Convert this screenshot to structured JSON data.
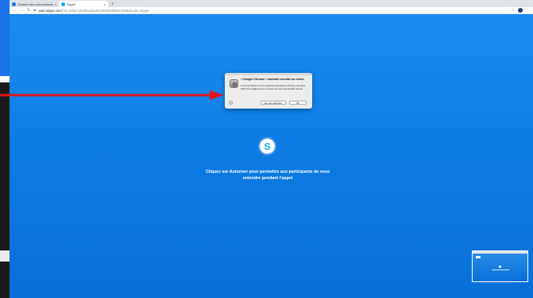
{
  "browser": {
    "tabs": [
      {
        "label": "Gestion des autorisations",
        "icon": "google-help-icon"
      },
      {
        "label": "Skype",
        "icon": "skype-icon"
      }
    ],
    "url_host": "web.skype.com",
    "url_path": "/?id=2054-4303b5434e8dc993d23bfd5c256d&Invite=skype",
    "new_tab_symbol": "+"
  },
  "dialog": {
    "title": "« Google Chrome » souhaite accéder au micro.",
    "body": "Une fois l'accès à une ressource accordé à Chrome, les sites Web sont également en mesure de vous demander l'accès.",
    "help_label": "?",
    "deny_label": "Ne pas autoriser",
    "ok_label": "OK"
  },
  "main": {
    "logo_letter": "S",
    "prompt_line1": "Cliquez sur Autoriser pour permettre aux participants de vous",
    "prompt_line2": "entendre pendant l'appel"
  },
  "colors": {
    "accent": "#0a7ce6",
    "arrow": "#e0151c"
  }
}
